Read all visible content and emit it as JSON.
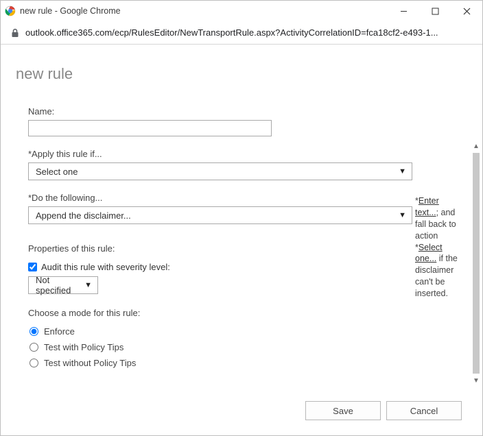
{
  "window": {
    "title": "new rule - Google Chrome"
  },
  "addressbar": {
    "url": "outlook.office365.com/ecp/RulesEditor/NewTransportRule.aspx?ActivityCorrelationID=fca18cf2-e493-1..."
  },
  "page": {
    "title": "new rule"
  },
  "form": {
    "name_label": "Name:",
    "name_value": "",
    "apply_label": "*Apply this rule if...",
    "apply_selected": "Select one",
    "do_label": "*Do the following...",
    "do_selected": "Append the disclaimer...",
    "side": {
      "prefix": "*",
      "link1": "Enter text...",
      "mid1": "; and fall back to action *",
      "link2": "Select one...",
      "suffix": " if the disclaimer can't be inserted."
    },
    "props_header": "Properties of this rule:",
    "audit_checked": true,
    "audit_label": "Audit this rule with severity level:",
    "audit_selected": "Not specified",
    "mode_header": "Choose a mode for this rule:",
    "modes": {
      "enforce": "Enforce",
      "test_tips": "Test with Policy Tips",
      "test_no_tips": "Test without Policy Tips"
    }
  },
  "footer": {
    "save": "Save",
    "cancel": "Cancel"
  }
}
